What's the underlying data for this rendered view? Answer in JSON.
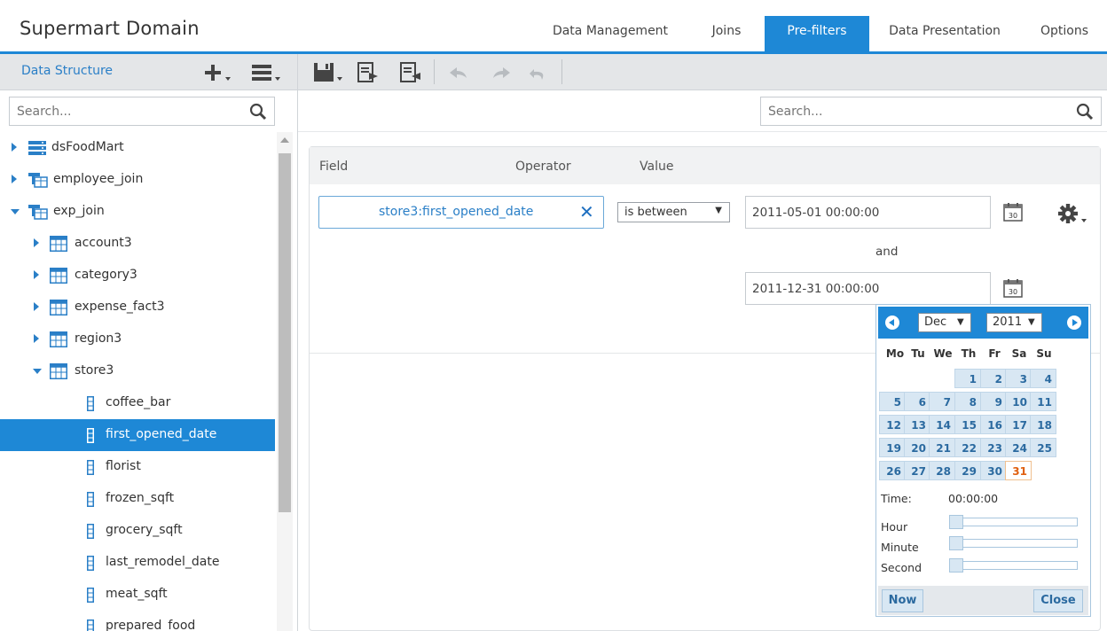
{
  "header": {
    "title": "Supermart Domain",
    "tabs": [
      {
        "label": "Data Management"
      },
      {
        "label": "Joins"
      },
      {
        "label": "Pre-filters",
        "active": true
      },
      {
        "label": "Data Presentation"
      },
      {
        "label": "Options"
      }
    ],
    "accent_color": "#1e88d6"
  },
  "left_panel": {
    "title": "Data Structure",
    "search_placeholder": "Search...",
    "tree": [
      {
        "label": "dsFoodMart",
        "icon": "datasource-icon",
        "expanded": false
      },
      {
        "label": "employee_join",
        "icon": "join-icon",
        "expanded": false
      },
      {
        "label": "exp_join",
        "icon": "join-icon",
        "expanded": true
      },
      {
        "label": "account3",
        "icon": "table-icon",
        "expanded": false
      },
      {
        "label": "category3",
        "icon": "table-icon",
        "expanded": false
      },
      {
        "label": "expense_fact3",
        "icon": "table-icon",
        "expanded": false
      },
      {
        "label": "region3",
        "icon": "table-icon",
        "expanded": false
      },
      {
        "label": "store3",
        "icon": "table-icon",
        "expanded": true
      },
      {
        "label": "coffee_bar",
        "icon": "field-icon"
      },
      {
        "label": "first_opened_date",
        "icon": "field-icon",
        "selected": true
      },
      {
        "label": "florist",
        "icon": "field-icon"
      },
      {
        "label": "frozen_sqft",
        "icon": "field-icon"
      },
      {
        "label": "grocery_sqft",
        "icon": "field-icon"
      },
      {
        "label": "last_remodel_date",
        "icon": "field-icon"
      },
      {
        "label": "meat_sqft",
        "icon": "field-icon"
      },
      {
        "label": "prepared_food",
        "icon": "field-icon"
      }
    ]
  },
  "right_panel": {
    "search_placeholder": "Search...",
    "columns": {
      "field": "Field",
      "operator": "Operator",
      "value": "Value"
    },
    "filter": {
      "field": "store3:first_opened_date",
      "operator": "is between",
      "value_from": "2011-05-01 00:00:00",
      "and_label": "and",
      "value_to": "2011-12-31 00:00:00"
    }
  },
  "calendar": {
    "month": "Dec",
    "year": "2011",
    "weekdays": [
      "Mo",
      "Tu",
      "We",
      "Th",
      "Fr",
      "Sa",
      "Su"
    ],
    "first_day_column": 3,
    "days_in_month": 31,
    "selected_day": 31,
    "time_label": "Time:",
    "time_value": "00:00:00",
    "hour_label": "Hour",
    "minute_label": "Minute",
    "second_label": "Second",
    "now_button": "Now",
    "close_button": "Close"
  }
}
